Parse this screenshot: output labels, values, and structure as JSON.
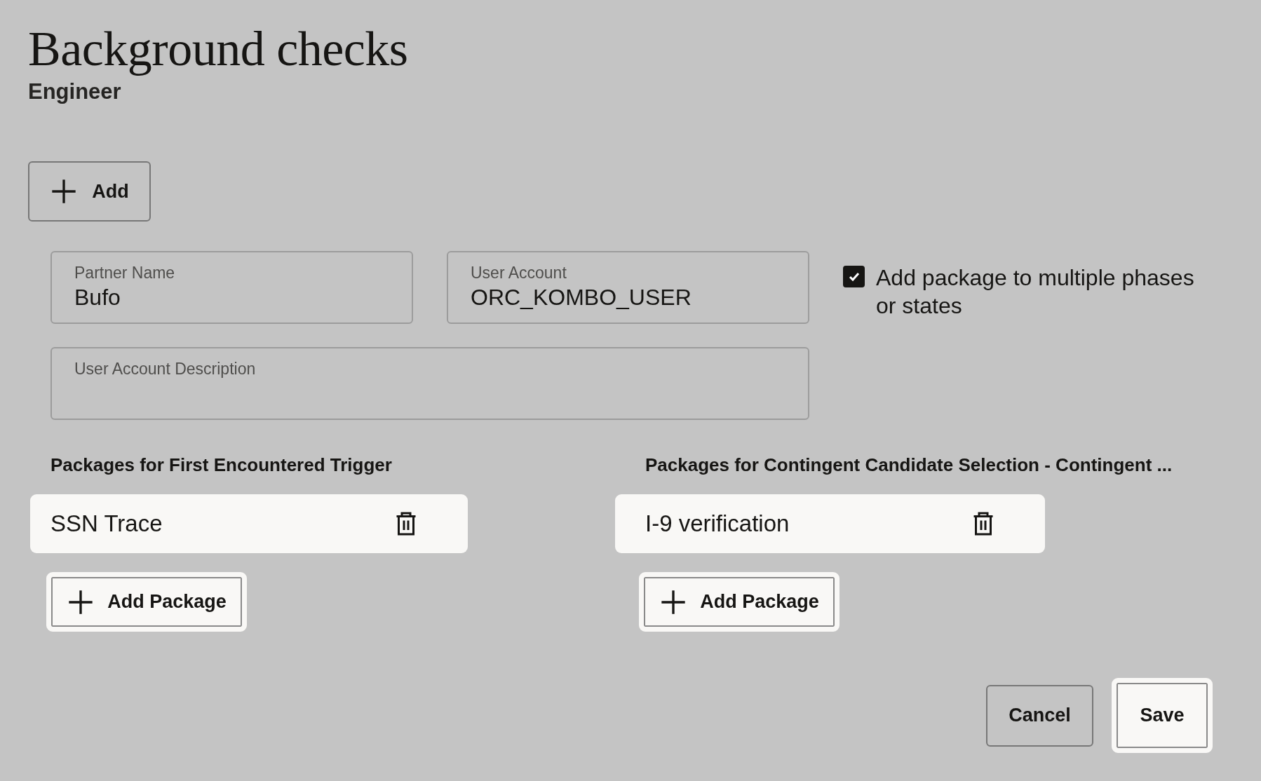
{
  "page": {
    "title": "Background checks",
    "subtitle": "Engineer"
  },
  "add_button": {
    "label": "Add",
    "highlighted": false
  },
  "fields": [
    {
      "label": "Partner Name",
      "value": "Bufo"
    },
    {
      "label": "User Account",
      "value": "ORC_KOMBO_USER"
    },
    {
      "label": "User Account Description"
    }
  ],
  "multi_phase_option": {
    "label": "Add package to multiple phases or states",
    "checked": true
  },
  "package_groups": [
    {
      "heading": "Packages for First Encountered Trigger",
      "packages": [
        {
          "name": "SSN Trace"
        }
      ],
      "add_button": {
        "label": "Add Package",
        "highlighted": true
      }
    },
    {
      "heading": "Packages for Contingent Candidate Selection - Contingent ...",
      "packages": [
        {
          "name": "I-9 verification"
        }
      ],
      "add_button": {
        "label": "Add Package",
        "highlighted": true
      }
    }
  ],
  "actions": [
    {
      "label": "Cancel",
      "highlighted": false
    },
    {
      "label": "Save",
      "highlighted": true
    }
  ]
}
